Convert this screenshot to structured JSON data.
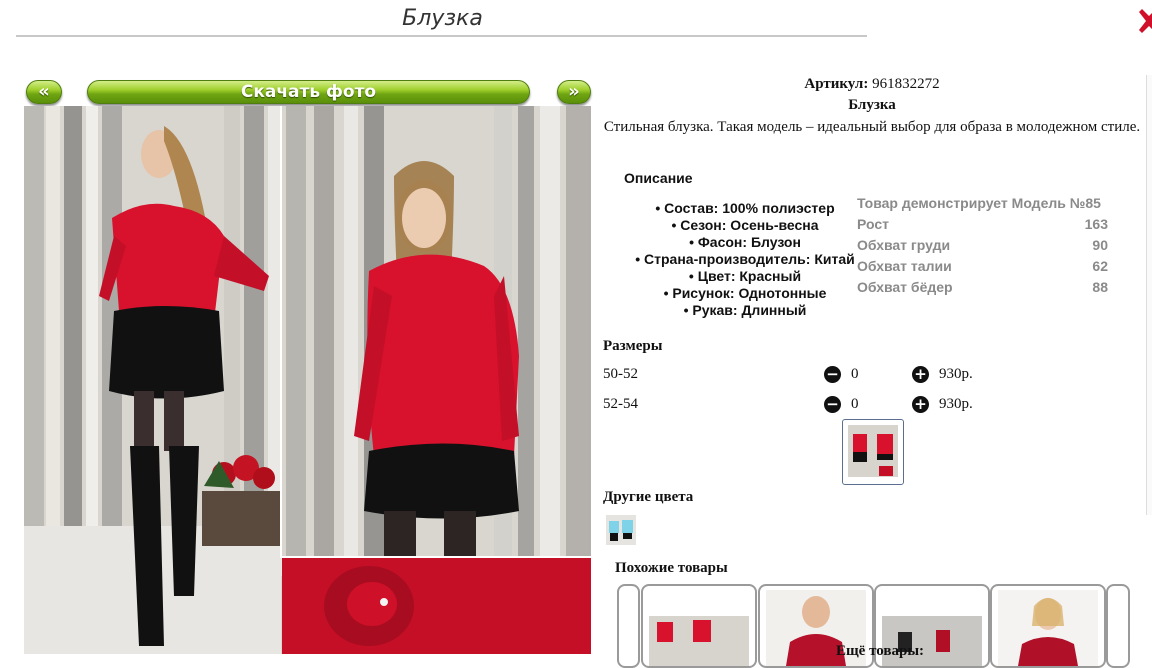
{
  "header": {
    "title": "Блузка"
  },
  "nav": {
    "prev_label": "«",
    "download_label": "Скачать фото",
    "next_label": "»"
  },
  "product": {
    "sku_label": "Артикул:",
    "sku": "961832272",
    "name": "Блузка",
    "description": "Стильная блузка. Такая модель – идеальный выбор для образа в молодежном стиле."
  },
  "description_section": {
    "heading": "Описание",
    "features": [
      "Состав: 100% полиэстер",
      "Сезон: Осень-весна",
      "Фасон: Блузон",
      "Страна-производитель: Китай",
      "Цвет: Красный",
      "Рисунок: Однотонные",
      "Рукав: Длинный"
    ]
  },
  "model": {
    "heading": "Товар демонстрирует Модель №85",
    "params": [
      {
        "label": "Рост",
        "value": "163"
      },
      {
        "label": "Обхват груди",
        "value": "90"
      },
      {
        "label": "Обхват талии",
        "value": "62"
      },
      {
        "label": "Обхват бёдер",
        "value": "88"
      }
    ]
  },
  "sizes": {
    "heading": "Размеры",
    "rows": [
      {
        "size": "50-52",
        "qty": "0",
        "price": "930р."
      },
      {
        "size": "52-54",
        "qty": "0",
        "price": "930р."
      }
    ],
    "minus_icon": "minus-circle-icon",
    "plus_icon": "plus-circle-icon"
  },
  "other_colors": {
    "heading": "Другие цвета"
  },
  "similar": {
    "heading": "Похожие товары",
    "more_label": "Ещё товары:"
  },
  "colors": {
    "accent_green": "#7ab51d",
    "blouse_red": "#d8112c"
  }
}
